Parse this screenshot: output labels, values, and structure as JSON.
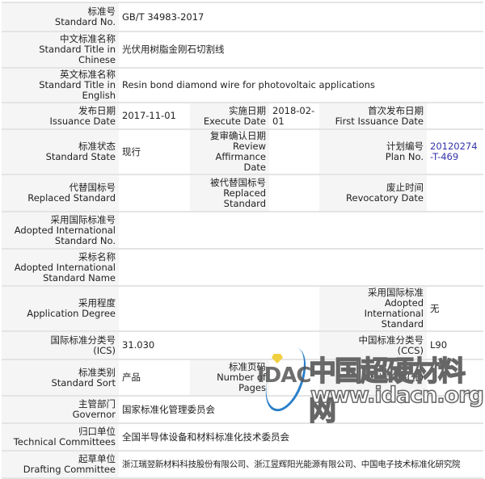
{
  "rows": {
    "standard_no": {
      "label_cn": "标准号",
      "label_en": "Standard No.",
      "value": "GB/T 34983-2017"
    },
    "title_cn": {
      "label_cn": "中文标准名称",
      "label_en": "Standard Title in Chinese",
      "value": "光伏用树脂金刚石切割线"
    },
    "title_en": {
      "label_cn": "英文标准名称",
      "label_en": "Standard Title in English",
      "value": "Resin bond diamond wire for photovoltaic applications"
    },
    "issuance_date": {
      "label_cn": "发布日期",
      "label_en": "Issuance Date",
      "value": "2017-11-01"
    },
    "execute_date": {
      "label_cn": "实施日期",
      "label_en": "Execute Date",
      "value": "2018-02-01"
    },
    "first_issuance_date": {
      "label_cn": "首次发布日期",
      "label_en": "First Issuance Date",
      "value": ""
    },
    "standard_state": {
      "label_cn": "标准状态",
      "label_en": "Standard State",
      "value": "现行"
    },
    "review_date": {
      "label_cn": "复审确认日期",
      "label_en": "Review Affirmance Date",
      "value": ""
    },
    "plan_no": {
      "label_cn": "计划编号",
      "label_en": "Plan No.",
      "value": "20120274-T-469"
    },
    "replaced_standard": {
      "label_cn": "代替国标号",
      "label_en": "Replaced Standard",
      "value": ""
    },
    "replaced_by": {
      "label_cn": "被代替国标号",
      "label_en": "Replaced Standard",
      "value": ""
    },
    "revocatory_date": {
      "label_cn": "废止时间",
      "label_en": "Revocatory Date",
      "value": ""
    },
    "adopted_intl_no": {
      "label_cn": "采用国际标准号",
      "label_en": "Adopted International Standard No.",
      "value": ""
    },
    "adopted_intl_name": {
      "label_cn": "采标名称",
      "label_en": "Adopted International Standard Name",
      "value": ""
    },
    "application_degree": {
      "label_cn": "采用程度",
      "label_en": "Application Degree",
      "value": ""
    },
    "adopted_intl_standard": {
      "label_cn": "采用国际标准",
      "label_en": "Adopted International Standard",
      "value": "无"
    },
    "ics": {
      "label_cn": "国际标准分类号",
      "label_en": "(ICS)",
      "value": "31.030"
    },
    "ccs": {
      "label_cn": "中国标准分类号",
      "label_en": "(CCS)",
      "value": "L90"
    },
    "standard_sort": {
      "label_cn": "标准类别",
      "label_en": "Standard Sort",
      "value": "产品"
    },
    "pages": {
      "label_cn": "标准页码",
      "label_en": "Number of Pages",
      "value": ""
    },
    "price": {
      "label_cn": "标准价格(元)",
      "label_en": "",
      "value": ""
    },
    "governor": {
      "label_cn": "主管部门",
      "label_en": "Governor",
      "value": "国家标准化管理委员会"
    },
    "technical_committees": {
      "label_cn": "归口单位",
      "label_en": "Technical Committees",
      "value": "全国半导体设备和材料标准化技术委员会"
    },
    "drafting_committee": {
      "label_cn": "起草单位",
      "label_en": "Drafting Committee",
      "value": "浙江瑞翌新材料科技股份有限公司、浙江昱辉阳光能源有限公司、中国电子技术标准化研究院"
    }
  },
  "watermark": {
    "logo": "IDAC",
    "site_name": "中国超硬材料网",
    "url": "www.idacn.org"
  },
  "colors": {
    "link": "#3333aa",
    "label_bg": "#f5f5f5",
    "border": "#e4e4e4"
  }
}
